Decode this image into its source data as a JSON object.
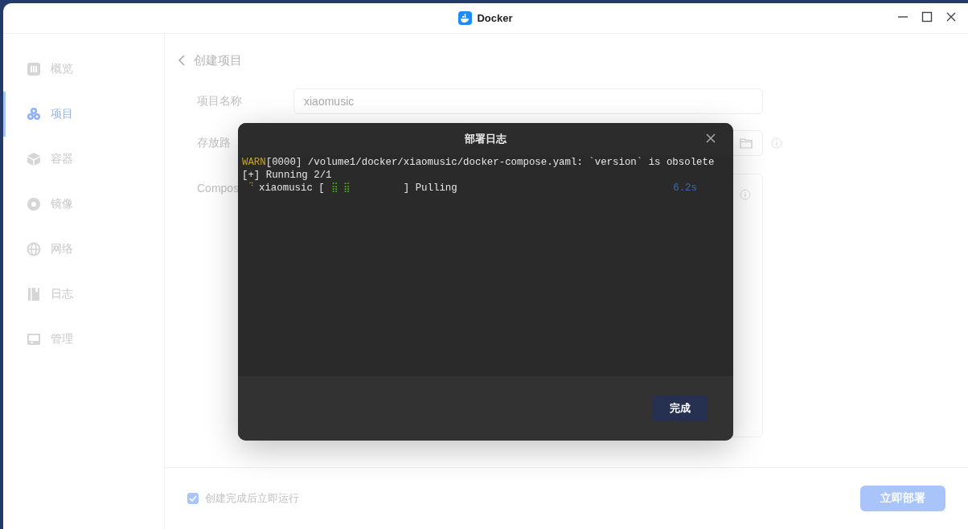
{
  "window": {
    "title": "Docker"
  },
  "sidebar": {
    "items": [
      {
        "label": "概览",
        "selected": false
      },
      {
        "label": "项目",
        "selected": true
      },
      {
        "label": "容器",
        "selected": false
      },
      {
        "label": "镜像",
        "selected": false
      },
      {
        "label": "网络",
        "selected": false
      },
      {
        "label": "日志",
        "selected": false
      },
      {
        "label": "管理",
        "selected": false
      }
    ]
  },
  "page": {
    "title": "创建项目",
    "fields": [
      {
        "label": "项目名称",
        "kind": "text",
        "value": "xiaomusic"
      },
      {
        "label": "存放路",
        "kind": "path"
      },
      {
        "label": "Compos",
        "kind": "editor"
      }
    ],
    "run_after_create": {
      "label": "创建完成后立即运行",
      "checked": true
    },
    "deploy_button": "立即部署"
  },
  "dialog": {
    "title": "部署日志",
    "log_lines": [
      [
        {
          "kind": "warn",
          "text": "WARN"
        },
        {
          "kind": "text",
          "text": "[0000] /volume1/docker/xiaomusic/docker-compose.yaml: `version` is obsolete"
        }
      ],
      [
        {
          "kind": "text",
          "text": "[+] Running 2/1"
        }
      ],
      [
        {
          "kind": "spinner",
          "text": "⠙"
        },
        {
          "kind": "text",
          "text": "xiaomusic ["
        },
        {
          "kind": "progress",
          "text": "⣿⣿"
        },
        {
          "kind": "text",
          "text": "] Pulling"
        },
        {
          "kind": "time",
          "text": "6.2s"
        }
      ]
    ],
    "done_button": "完成"
  }
}
